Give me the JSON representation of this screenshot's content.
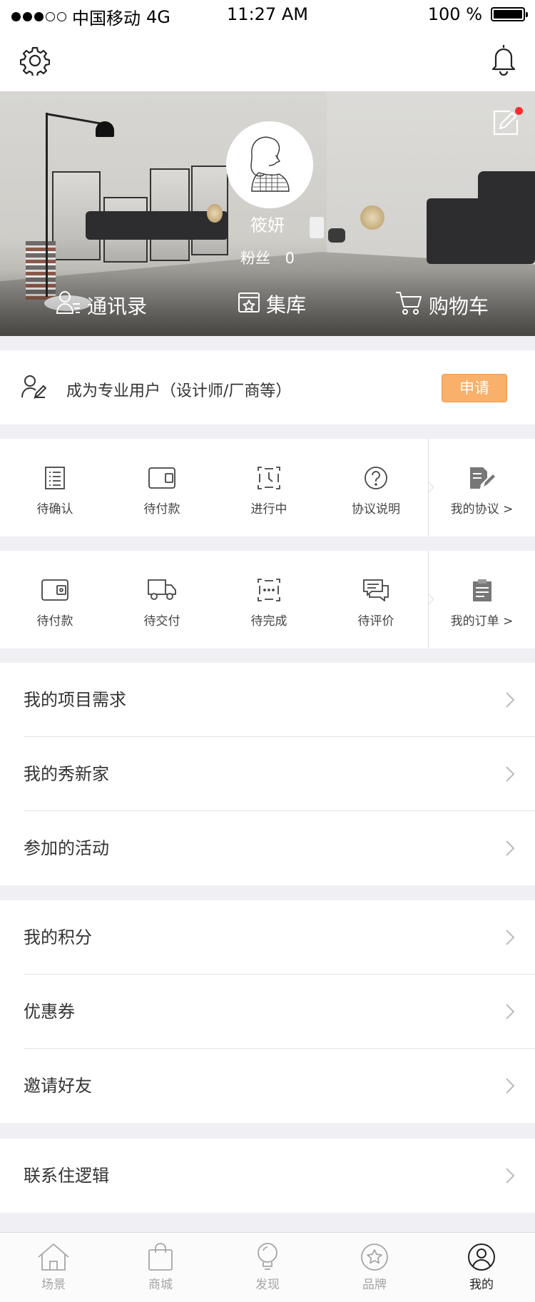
{
  "status_bar": {
    "carrier": "中国移动",
    "network": "4G",
    "time": "11:27 AM",
    "battery": "100 %"
  },
  "nav": {
    "settings_icon": "gear-icon",
    "notification_icon": "bell-icon"
  },
  "profile": {
    "name": "筱妍",
    "fans_label": "粉丝",
    "fans_count": "0",
    "edit_icon": "edit-icon",
    "edit_badge_color": "#ff2a2a",
    "links": [
      {
        "label": "通讯录",
        "icon": "contacts-icon"
      },
      {
        "label": "集库",
        "icon": "collection-icon"
      },
      {
        "label": "购物车",
        "icon": "cart-icon"
      }
    ]
  },
  "pro_user": {
    "text": "成为专业用户（设计师/厂商等）",
    "apply_label": "申请",
    "accent": "#f9b06a"
  },
  "agreements": {
    "items": [
      {
        "label": "待确认",
        "icon": "checklist-icon"
      },
      {
        "label": "待付款",
        "icon": "wallet-icon"
      },
      {
        "label": "进行中",
        "icon": "clock-icon"
      },
      {
        "label": "协议说明",
        "icon": "question-icon"
      }
    ],
    "side_label": "我的协议 >",
    "side_icon": "document-edit-icon"
  },
  "orders": {
    "items": [
      {
        "label": "待付款",
        "icon": "wallet-icon"
      },
      {
        "label": "待交付",
        "icon": "truck-icon"
      },
      {
        "label": "待完成",
        "icon": "more-box-icon"
      },
      {
        "label": "待评价",
        "icon": "comment-icon"
      }
    ],
    "side_label": "我的订单 >",
    "side_icon": "clipboard-icon"
  },
  "menu_groups": [
    [
      "我的项目需求",
      "我的秀新家",
      "参加的活动"
    ],
    [
      "我的积分",
      "优惠券",
      "邀请好友"
    ],
    [
      "联系住逻辑"
    ]
  ],
  "tabs": [
    {
      "label": "场景",
      "icon": "house-icon"
    },
    {
      "label": "商城",
      "icon": "shopping-bag-icon"
    },
    {
      "label": "发现",
      "icon": "bulb-icon"
    },
    {
      "label": "品牌",
      "icon": "star-circle-icon"
    },
    {
      "label": "我的",
      "icon": "user-circle-icon",
      "active": true
    }
  ]
}
